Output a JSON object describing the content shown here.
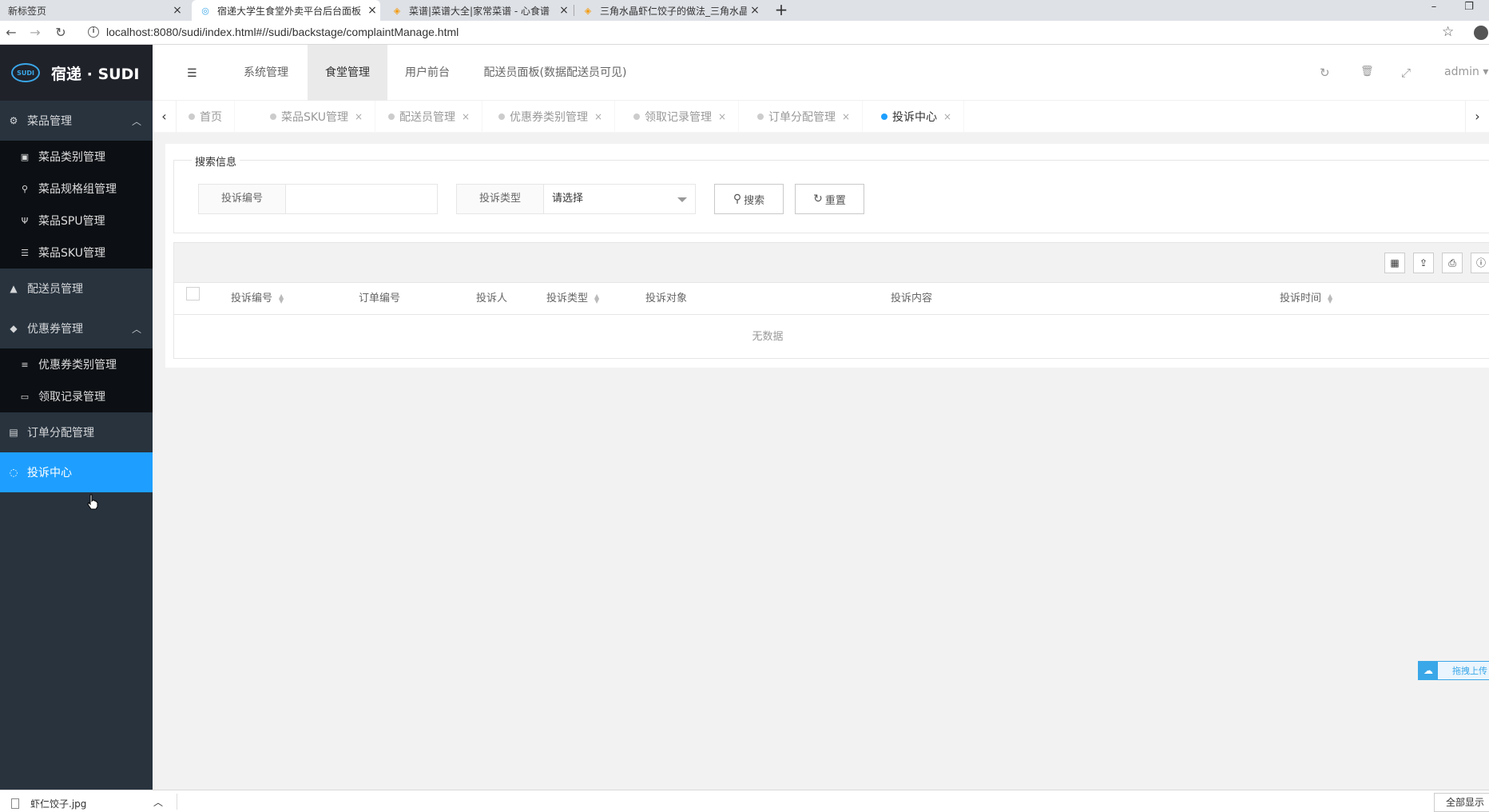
{
  "browser": {
    "tabs": [
      {
        "title": "新标签页",
        "close": "×"
      },
      {
        "title": "宿递大学生食堂外卖平台后台面板",
        "close": "×"
      },
      {
        "title": "菜谱|菜谱大全|家常菜谱 - 心食谱",
        "close": "×"
      },
      {
        "title": "三角水晶虾仁饺子的做法_三角水晶",
        "close": "×"
      }
    ],
    "new_tab": "+",
    "window_controls": [
      "–",
      "❐"
    ],
    "nav": {
      "back": "←",
      "forward": "→",
      "reload": "↻"
    },
    "url": "localhost:8080/sudi/index.html#//sudi/backstage/complaintManage.html",
    "star": "☆"
  },
  "logo": {
    "circle": "SUDI",
    "text": "宿递 · SUDI"
  },
  "header": {
    "menu_icon": "☰",
    "nav": [
      "系统管理",
      "食堂管理",
      "用户前台",
      "配送员面板(数据配送员可见)"
    ],
    "active_nav": "食堂管理",
    "icons": {
      "refresh": "↻",
      "delete": "🗑",
      "fullscreen": "⤢"
    },
    "user": "admin ▾"
  },
  "sidebar": {
    "groups": [
      {
        "label": "菜品管理",
        "icon": "⚙",
        "arrow": "︿"
      },
      {
        "label": "配送员管理",
        "icon": "▲"
      },
      {
        "label": "优惠券管理",
        "icon": "◆",
        "arrow": "︿"
      },
      {
        "label": "订单分配管理",
        "icon": "▤"
      },
      {
        "label": "投诉中心",
        "icon": "◌"
      }
    ],
    "dish_sub": [
      {
        "label": "菜品类别管理",
        "icon": "▣"
      },
      {
        "label": "菜品规格组管理",
        "icon": "⚲"
      },
      {
        "label": "菜品SPU管理",
        "icon": "Ψ"
      },
      {
        "label": "菜品SKU管理",
        "icon": "☰"
      }
    ],
    "coupon_sub": [
      {
        "label": "优惠券类别管理",
        "icon": "≡"
      },
      {
        "label": "领取记录管理",
        "icon": "▭"
      }
    ]
  },
  "page_tabs": {
    "prev": "‹",
    "next": "›",
    "close": "×",
    "items": [
      "首页",
      "菜品SKU管理",
      "配送员管理",
      "优惠券类别管理",
      "领取记录管理",
      "订单分配管理",
      "投诉中心"
    ]
  },
  "search": {
    "legend": "搜索信息",
    "complaint_no_label": "投诉编号",
    "complaint_no_value": "",
    "type_label": "投诉类型",
    "type_value": "请选择",
    "search_btn": "搜索",
    "search_icon": "⚲",
    "reset_btn": "重置",
    "reset_icon": "↻"
  },
  "table": {
    "toolbar_icons": [
      "▦",
      "⇪",
      "⎙",
      "ⓘ"
    ],
    "columns": [
      "投诉编号",
      "订单编号",
      "投诉人",
      "投诉类型",
      "投诉对象",
      "投诉内容",
      "投诉时间"
    ],
    "sort_glyph": "▲▼",
    "empty": "无数据"
  },
  "upload_widget": {
    "label": "拖拽上传"
  },
  "download_shelf": {
    "file": "虾仁饺子.jpg",
    "caret": "︿",
    "show_all": "全部显示"
  }
}
